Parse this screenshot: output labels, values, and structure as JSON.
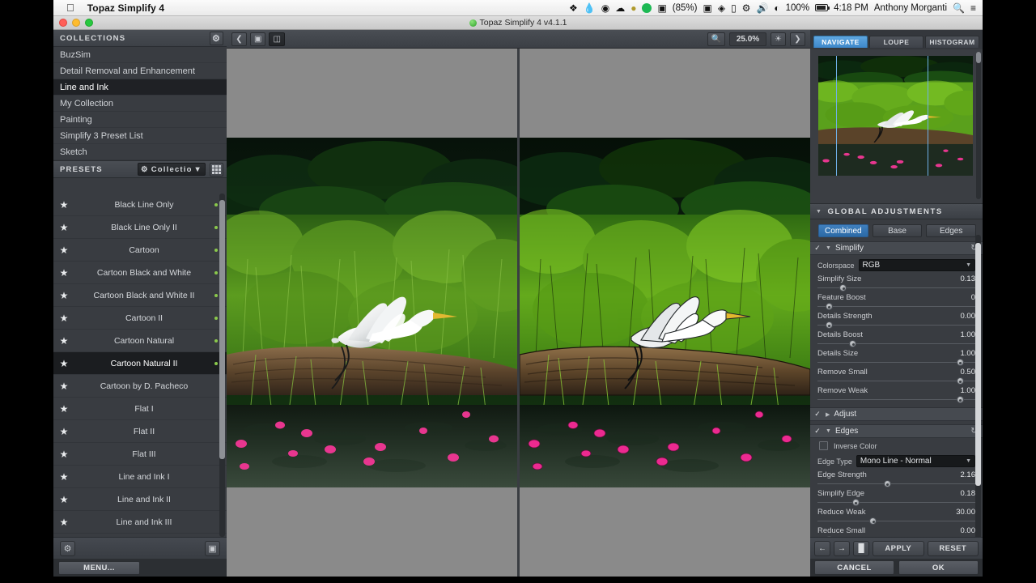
{
  "menubar": {
    "apple_icon": "apple-logo",
    "app_name": "Topaz Simplify 4",
    "status_items": [
      "dropbox-icon",
      "droplet-icon",
      "shutter-icon",
      "cloud-icon",
      "dollar-icon",
      "spotify-icon"
    ],
    "time_machine_pct": "(85%)",
    "battery_pct": "100%",
    "clock": "4:18 PM",
    "user": "Anthony Morganti",
    "search_icon": "search-icon",
    "notif_icon": "notification-center-icon"
  },
  "window": {
    "title": "Topaz Simplify 4 v4.1.1"
  },
  "collections": {
    "header": "COLLECTIONS",
    "gear_icon": "gear-icon",
    "items": [
      {
        "label": "BuzSim",
        "selected": false
      },
      {
        "label": "Detail Removal and Enhancement",
        "selected": false
      },
      {
        "label": "Line and Ink",
        "selected": true
      },
      {
        "label": "My Collection",
        "selected": false
      },
      {
        "label": "Painting",
        "selected": false
      },
      {
        "label": "Simplify 3 Preset List",
        "selected": false
      },
      {
        "label": "Sketch",
        "selected": false
      }
    ]
  },
  "presets": {
    "header": "PRESETS",
    "dropdown_label": "Collection...",
    "dropdown_icon": "gear-icon",
    "grid_icon": "grid-view-icon",
    "items": [
      {
        "label": "Black Line Only",
        "selected": false
      },
      {
        "label": "Black Line Only II",
        "selected": false
      },
      {
        "label": "Cartoon",
        "selected": false
      },
      {
        "label": "Cartoon Black and White",
        "selected": false
      },
      {
        "label": "Cartoon Black and White II",
        "selected": false
      },
      {
        "label": "Cartoon II",
        "selected": false
      },
      {
        "label": "Cartoon Natural",
        "selected": false
      },
      {
        "label": "Cartoon Natural II",
        "selected": true
      },
      {
        "label": "Cartoon by D. Pacheco",
        "selected": false
      },
      {
        "label": "Flat I",
        "selected": false
      },
      {
        "label": "Flat II",
        "selected": false
      },
      {
        "label": "Flat III",
        "selected": false
      },
      {
        "label": "Line and Ink I",
        "selected": false
      },
      {
        "label": "Line and Ink II",
        "selected": false
      },
      {
        "label": "Line and Ink III",
        "selected": false
      }
    ],
    "footer_gear_icon": "gear-icon",
    "footer_camera_icon": "camera-snapshot-icon"
  },
  "left_footer": {
    "menu_button": "MENU..."
  },
  "canvas_toolbar": {
    "back_icon": "chevron-left-icon",
    "single_view_icon": "single-image-view-icon",
    "split_view_icon": "split-image-view-icon",
    "zoom_icon": "magnifier-icon",
    "zoom_level": "25.0%",
    "light_icon": "lightbulb-icon",
    "forward_icon": "chevron-right-icon"
  },
  "navigator": {
    "tabs": [
      {
        "label": "NAVIGATE",
        "active": true
      },
      {
        "label": "LOUPE",
        "active": false
      },
      {
        "label": "HISTOGRAM",
        "active": false
      }
    ],
    "viewbox_color": "#6fb0e8"
  },
  "global_adjustments": {
    "header": "GLOBAL ADJUSTMENTS",
    "mode_tabs": [
      {
        "label": "Combined",
        "active": true
      },
      {
        "label": "Base",
        "active": false
      },
      {
        "label": "Edges",
        "active": false
      }
    ],
    "sections": [
      {
        "name": "Simplify",
        "enabled": true,
        "expanded": true,
        "reset_icon": "reset-icon",
        "dropdown": {
          "label": "Colorspace",
          "value": "RGB"
        },
        "sliders": [
          {
            "label": "Simplify Size",
            "value": "0.13",
            "pos": 14
          },
          {
            "label": "Feature Boost",
            "value": "0",
            "pos": 5
          },
          {
            "label": "Details Strength",
            "value": "0.00",
            "pos": 5
          },
          {
            "label": "Details Boost",
            "value": "1.00",
            "pos": 20
          },
          {
            "label": "Details Size",
            "value": "1.00",
            "pos": 90
          },
          {
            "label": "Remove Small",
            "value": "0.50",
            "pos": 90
          },
          {
            "label": "Remove Weak",
            "value": "1.00",
            "pos": 90
          }
        ]
      },
      {
        "name": "Adjust",
        "enabled": true,
        "expanded": false,
        "sliders": []
      },
      {
        "name": "Edges",
        "enabled": true,
        "expanded": true,
        "reset_icon": "reset-icon",
        "checkbox": {
          "label": "Inverse Color",
          "checked": false
        },
        "dropdown": {
          "label": "Edge Type",
          "value": "Mono Line - Normal"
        },
        "sliders": [
          {
            "label": "Edge Strength",
            "value": "2.16",
            "pos": 42
          },
          {
            "label": "Simplify Edge",
            "value": "0.18",
            "pos": 22
          },
          {
            "label": "Reduce Weak",
            "value": "30.00",
            "pos": 33
          },
          {
            "label": "Reduce Small",
            "value": "0.00",
            "pos": 5
          }
        ]
      }
    ]
  },
  "right_footer": {
    "undo_icon": "undo-arrow-icon",
    "redo_icon": "redo-arrow-icon",
    "mask_icon": "mask-brush-icon",
    "apply_label": "APPLY",
    "reset_label": "RESET",
    "cancel_label": "CANCEL",
    "ok_label": "OK"
  }
}
